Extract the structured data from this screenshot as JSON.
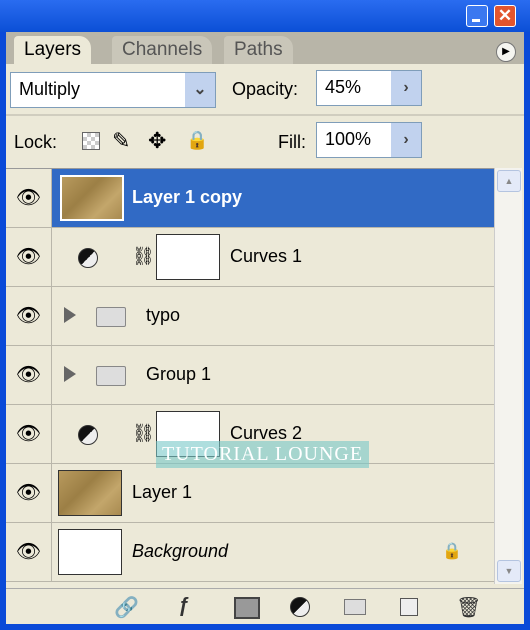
{
  "window": {
    "minimize": "minimize",
    "close": "✕"
  },
  "tabs": [
    {
      "label": "Layers",
      "active": true
    },
    {
      "label": "Channels"
    },
    {
      "label": "Paths"
    }
  ],
  "blend_mode": "Multiply",
  "opacity": {
    "label": "Opacity:",
    "value": "45%"
  },
  "lock": {
    "label": "Lock:"
  },
  "fill": {
    "label": "Fill:",
    "value": "100%"
  },
  "layers": [
    {
      "name": "Layer 1 copy",
      "type": "image",
      "selected": true
    },
    {
      "name": "Curves 1",
      "type": "adjustment"
    },
    {
      "name": "typo",
      "type": "group"
    },
    {
      "name": "Group 1",
      "type": "group"
    },
    {
      "name": "Curves 2",
      "type": "adjustment"
    },
    {
      "name": "Layer 1",
      "type": "image"
    },
    {
      "name": "Background",
      "type": "background",
      "locked": true
    }
  ],
  "watermark": "TUTORIAL LOUNGE",
  "colors": {
    "selection": "#316ac5",
    "panel": "#ece9d8",
    "window": "#0a4ad8"
  }
}
